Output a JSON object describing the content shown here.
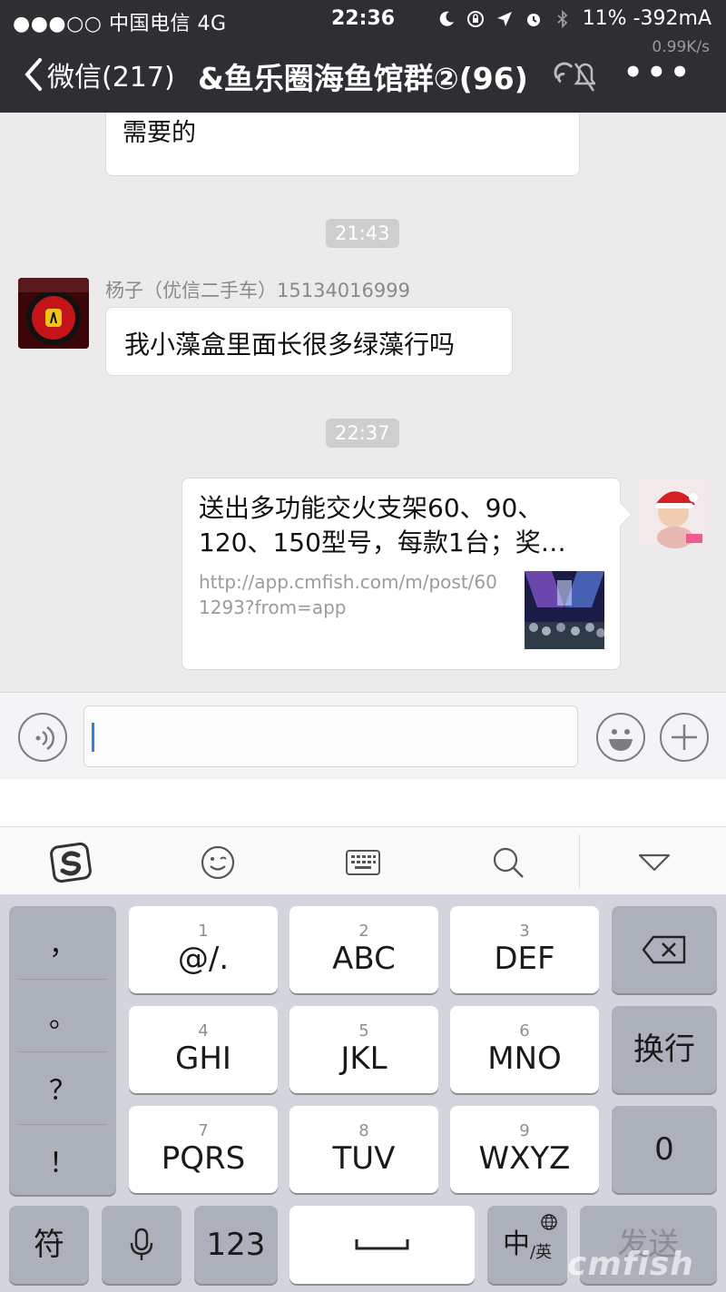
{
  "status_bar": {
    "carrier": "●●●○○ 中国电信   4G",
    "time": "22:36",
    "battery": "11% -392mA",
    "net_speed": "0.99K/s",
    "icons": [
      "moon-icon",
      "rotation-lock-icon",
      "location-arrow-icon",
      "alarm-icon",
      "bluetooth-icon"
    ]
  },
  "nav": {
    "back_label": "微信(217)",
    "title": "&鱼乐圈海鱼馆群②(96)",
    "more_label": "•••"
  },
  "chat": {
    "partial_message_line2": "需要的",
    "timestamp_1": "21:43",
    "sender_name": "杨子（优信二手车）15134016999",
    "message_1": "我小藻盒里面长很多绿藻行吗",
    "timestamp_2": "22:37",
    "link_card": {
      "title": "送出多功能交火支架60、90、120、150型号，每款1台；奖…",
      "url": "http://app.cmfish.com/m/post/601293?from=app"
    }
  },
  "ime_toolbar": {
    "icons": [
      "sogou-logo-icon",
      "emoji-face-icon",
      "keyboard-icon",
      "search-icon",
      "collapse-triangle-icon"
    ]
  },
  "keyboard": {
    "punctuation": [
      "，",
      "。",
      "？",
      "！"
    ],
    "keys": [
      {
        "num": "1",
        "label": "@/."
      },
      {
        "num": "2",
        "label": "ABC"
      },
      {
        "num": "3",
        "label": "DEF"
      },
      {
        "num": "4",
        "label": "GHI"
      },
      {
        "num": "5",
        "label": "JKL"
      },
      {
        "num": "6",
        "label": "MNO"
      },
      {
        "num": "7",
        "label": "PQRS"
      },
      {
        "num": "8",
        "label": "TUV"
      },
      {
        "num": "9",
        "label": "WXYZ"
      }
    ],
    "newline_label": "换行",
    "zero_label": "0",
    "symbols_label": "符",
    "num_label": "123",
    "space_label": "␣",
    "lang_label": "中",
    "lang_sub": "/英",
    "send_label": "发送"
  },
  "watermark": "cmfish"
}
